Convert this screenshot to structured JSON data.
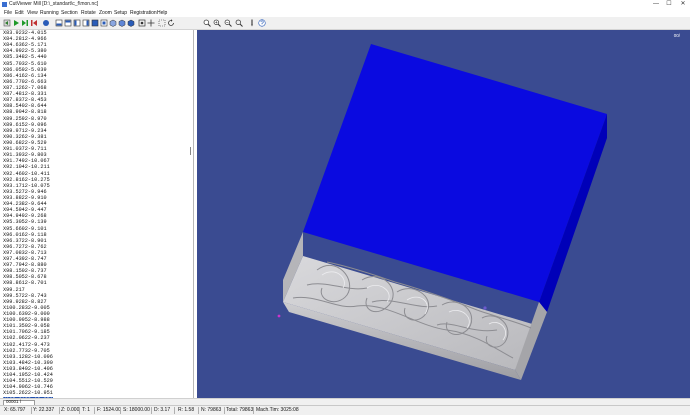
{
  "window": {
    "title": "CutViewer Mill [D:\\_standart\\c_f\\mon.nc]",
    "minimize": "—",
    "maximize": "☐",
    "close": "✕"
  },
  "menu": [
    "File",
    "Edit",
    "View",
    "Running",
    "Section",
    "Rotate",
    "Zoom",
    "Setup",
    "Registration",
    "Help"
  ],
  "toolbar": {
    "icons": [
      "step-back-icon",
      "play-icon",
      "step-forward-icon",
      "rewind-icon",
      "shaded-view-icon",
      "view-front-icon",
      "view-back-icon",
      "view-left-icon",
      "view-right-icon",
      "view-top-icon",
      "view-bottom-icon",
      "view-iso-icon",
      "view-dimetric-icon",
      "view-trimetric-icon",
      "zoom-fit-icon",
      "pan-icon",
      "zoom-in-icon",
      "zoom-out-icon",
      "zoom-window-icon",
      "rotate-icon",
      "measure-icon",
      "tool-icon",
      "help-icon"
    ]
  },
  "gcode": {
    "lines": [
      "X83.9232-4.015",
      "X84.2812-4.966",
      "X84.6362-5.171",
      "X84.9922-5.380",
      "X85.3482-5.440",
      "X85.7032-5.610",
      "X86.0592-5.039",
      "X86.4162-6.134",
      "X86.7702-6.663",
      "X87.1262-7.068",
      "X87.4812-8.331",
      "X87.8372-8.453",
      "X88.5402-8.644",
      "X88.9042-8.818",
      "X89.2592-8.970",
      "X89.6152-9.096",
      "X89.9712-9.234",
      "X90.3262-9.381",
      "X90.6822-9.529",
      "X91.0372-9.711",
      "X91.3932-9.803",
      "X91.7492-10.067",
      "X92.1042-10.211",
      "X92.4602-10.411",
      "X92.8162-10.275",
      "X93.1712-10.075",
      "X93.5272-9.946",
      "X93.8822-9.910",
      "X94.2382-9.644",
      "X94.5942-9.447",
      "X94.9492-9.268",
      "X95.3052-9.139",
      "X95.6602-9.101",
      "X96.0162-9.118",
      "X96.3722-8.901",
      "X96.7272-8.762",
      "X97.0832-8.713",
      "X97.4392-8.747",
      "X97.7942-8.880",
      "X98.1502-8.737",
      "X98.5052-8.678",
      "X98.8612-8.701",
      "X99.217",
      "X99.5722-8.743",
      "X99.9282-8.827",
      "X100.2832-9.005",
      "X100.6392-9.000",
      "X100.9952-8.988",
      "X101.3502-9.058",
      "X101.7062-9.185",
      "X102.0622-9.237",
      "X102.4172-9.473",
      "X102.7732-9.705",
      "X103.1282-10.096",
      "X103.4842-10.390",
      "X103.8402-10.406",
      "X104.1952-10.424",
      "X104.5512-10.529",
      "X104.9062-10.746",
      "X105.2622-10.951",
      "X105.6182-10.951",
      "X105.9732-10.918"
    ],
    "current_index": 60
  },
  "progress": {
    "label": "00001 l"
  },
  "status": {
    "x": "X: 65.797",
    "y": "Y: 22.337",
    "z": "Z: 0.000",
    "t": "T: 1",
    "f": "F: 1524.00",
    "s": "S: 18000.00",
    "d": "D: 3.17",
    "r": "R: 1.58",
    "n": "N: 79863",
    "total": "Total: 79863",
    "mach_tim": "Mach.Tim: 3025:08"
  },
  "viewport": {
    "corner_label": "00/"
  },
  "colors": {
    "background": "#3a4b91",
    "stock_top": "#0a0ae0",
    "stock_side": "#0000c0",
    "relief": "#c9c9cc"
  }
}
